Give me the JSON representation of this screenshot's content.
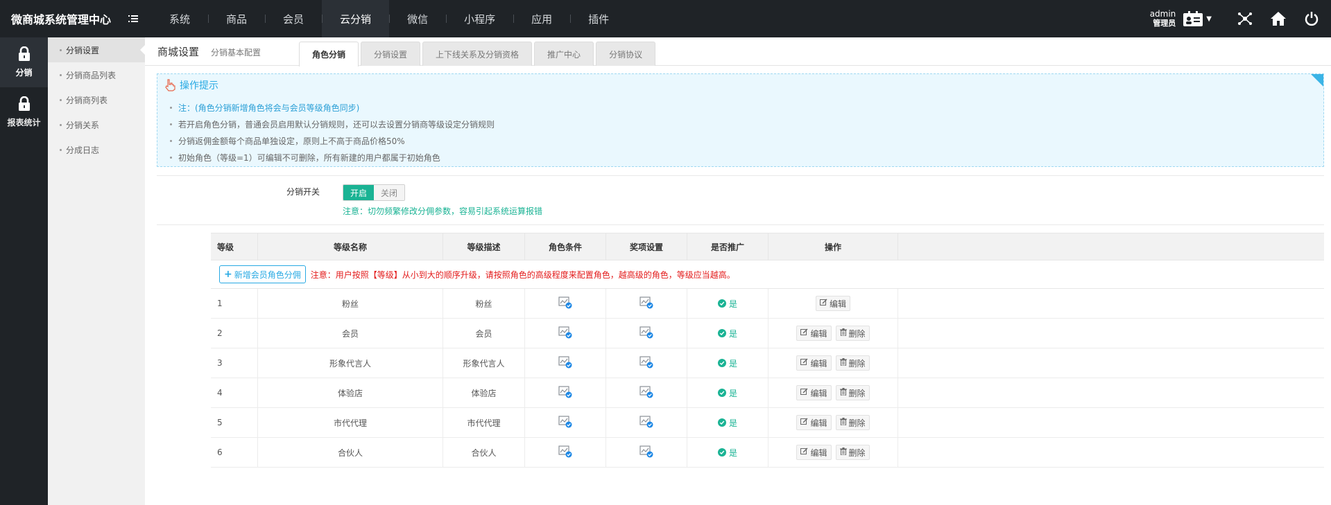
{
  "brand": "微商城系统管理中心",
  "nav": [
    "系统",
    "商品",
    "会员",
    "云分销",
    "微信",
    "小程序",
    "应用",
    "插件"
  ],
  "nav_active": 3,
  "user": {
    "name": "admin",
    "role": "管理员"
  },
  "leftbar": [
    {
      "label": "分销",
      "icon": "lock-icon",
      "active": true
    },
    {
      "label": "报表统计",
      "icon": "lock-icon",
      "active": false
    }
  ],
  "subnav": [
    "分销设置",
    "分销商品列表",
    "分销商列表",
    "分销关系",
    "分成日志"
  ],
  "subnav_active": 0,
  "page": {
    "title": "商城设置",
    "subtitle": "分销基本配置"
  },
  "tabs": [
    "角色分销",
    "分销设置",
    "上下线关系及分销资格",
    "推广中心",
    "分销协议"
  ],
  "tabs_active": 0,
  "tips": {
    "title": "操作提示",
    "items": [
      "注：(角色分销新增角色将会与会员等级角色同步)",
      "若开启角色分销，普通会员启用默认分销规则，还可以去设置分销商等级设定分销规则",
      "分销返佣金额每个商品单独设定，原则上不高于商品价格50%",
      "初始角色（等级=1）可编辑不可删除，所有新建的用户都属于初始角色"
    ]
  },
  "switch": {
    "label": "分销开关",
    "on": "开启",
    "off": "关闭",
    "note": "注意：切勿频繁修改分佣参数，容易引起系统运算报错"
  },
  "table": {
    "headers": [
      "等级",
      "等级名称",
      "等级描述",
      "角色条件",
      "奖项设置",
      "是否推广",
      "操作"
    ],
    "add_button": "新增会员角色分佣",
    "add_note": "注意：用户按照【等级】从小到大的顺序升级，请按照角色的高级程度来配置角色，越高级的角色，等级应当越高。",
    "edit_label": "编辑",
    "delete_label": "删除",
    "rows": [
      {
        "level": "1",
        "name": "粉丝",
        "desc": "粉丝",
        "promote": "是",
        "deletable": false
      },
      {
        "level": "2",
        "name": "会员",
        "desc": "会员",
        "promote": "是",
        "deletable": true
      },
      {
        "level": "3",
        "name": "形象代言人",
        "desc": "形象代言人",
        "promote": "是",
        "deletable": true
      },
      {
        "level": "4",
        "name": "体验店",
        "desc": "体验店",
        "promote": "是",
        "deletable": true
      },
      {
        "level": "5",
        "name": "市代代理",
        "desc": "市代代理",
        "promote": "是",
        "deletable": true
      },
      {
        "level": "6",
        "name": "合伙人",
        "desc": "合伙人",
        "promote": "是",
        "deletable": true
      }
    ]
  },
  "colors": {
    "topbar": "#1f2327",
    "accent_green": "#1ab394",
    "accent_blue": "#27a9e3",
    "warn_red": "#e31b1b"
  }
}
